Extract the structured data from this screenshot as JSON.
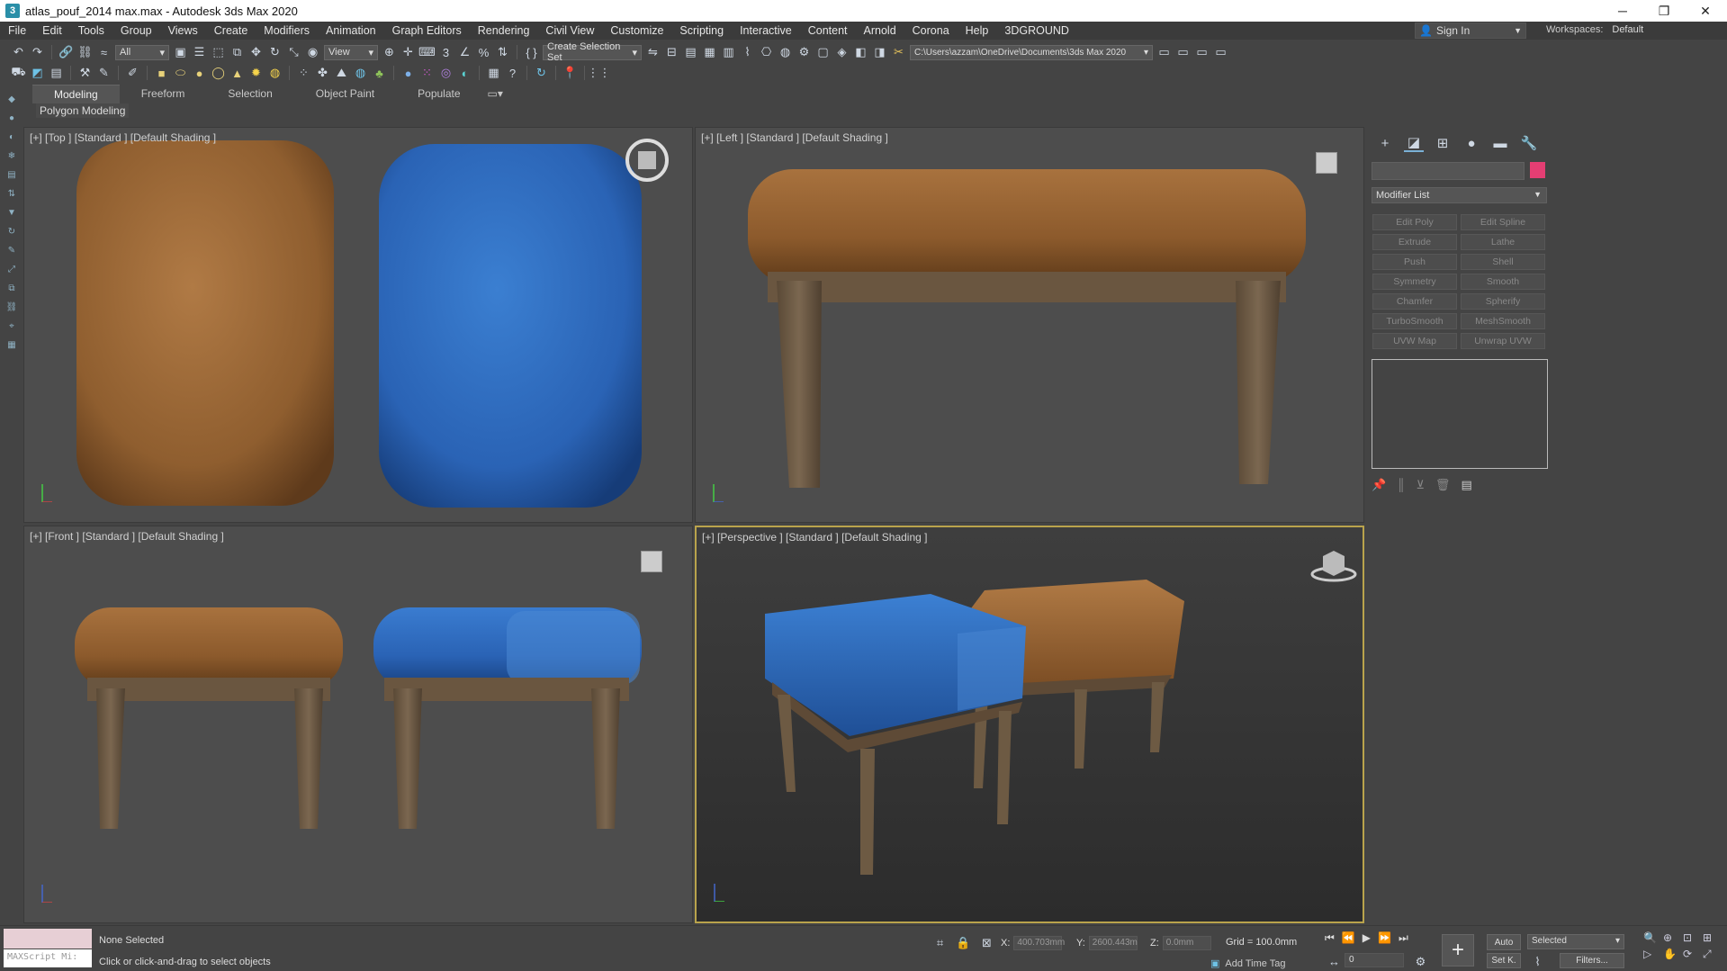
{
  "window": {
    "title": "atlas_pouf_2014 max.max - Autodesk 3ds Max 2020",
    "app_icon": "3",
    "controls": {
      "minimize": "─",
      "restore": "❐",
      "close": "✕"
    }
  },
  "menu": [
    "File",
    "Edit",
    "Tools",
    "Group",
    "Views",
    "Create",
    "Modifiers",
    "Animation",
    "Graph Editors",
    "Rendering",
    "Civil View",
    "Customize",
    "Scripting",
    "Interactive",
    "Content",
    "Arnold",
    "Corona",
    "Help",
    "3DGROUND"
  ],
  "account": {
    "sign_in": "Sign In",
    "workspaces_label": "Workspaces:",
    "workspace_value": "Default"
  },
  "toolbar": {
    "filter_value": "All",
    "refcoord_value": "View",
    "selection_set_value": "Create Selection Set",
    "project_path": "C:\\Users\\azzam\\OneDrive\\Documents\\3ds Max 2020"
  },
  "ribbon": {
    "tabs": [
      "Modeling",
      "Freeform",
      "Selection",
      "Object Paint",
      "Populate"
    ],
    "active_tab": "Modeling",
    "panel_label": "Polygon Modeling"
  },
  "viewports": {
    "top": "[+] [Top ] [Standard ] [Default Shading ]",
    "left": "[+] [Left ] [Standard ] [Default Shading ]",
    "front": "[+] [Front ] [Standard ] [Default Shading ]",
    "perspective": "[+] [Perspective ] [Standard ] [Default Shading ]"
  },
  "command_panel": {
    "object_color": "#e43e73",
    "modifier_list": "Modifier List",
    "modifier_buttons": [
      "Edit Poly",
      "Edit Spline",
      "Extrude",
      "Lathe",
      "Push",
      "Shell",
      "Symmetry",
      "Smooth",
      "Chamfer",
      "Spherify",
      "TurboSmooth",
      "MeshSmooth",
      "UVW Map",
      "Unwrap UVW"
    ]
  },
  "status": {
    "selection": "None Selected",
    "prompt": "Click or click-and-drag to select objects",
    "maxscript_placeholder": "MAXScript Mi:",
    "x_label": "X:",
    "x_value": "400.703mm",
    "y_label": "Y:",
    "y_value": "2600.443m",
    "z_label": "Z:",
    "z_value": "0.0mm",
    "grid": "Grid = 100.0mm",
    "add_time_tag": "Add Time Tag",
    "frame": "0",
    "auto_key": "Auto",
    "set_key": "Set K.",
    "key_filter_value": "Selected",
    "filters": "Filters..."
  },
  "colors": {
    "leather": "#9a6634",
    "fabric": "#2f6cc0",
    "wood": "#6d5a43",
    "active_viewport_border": "#b9a34c"
  }
}
